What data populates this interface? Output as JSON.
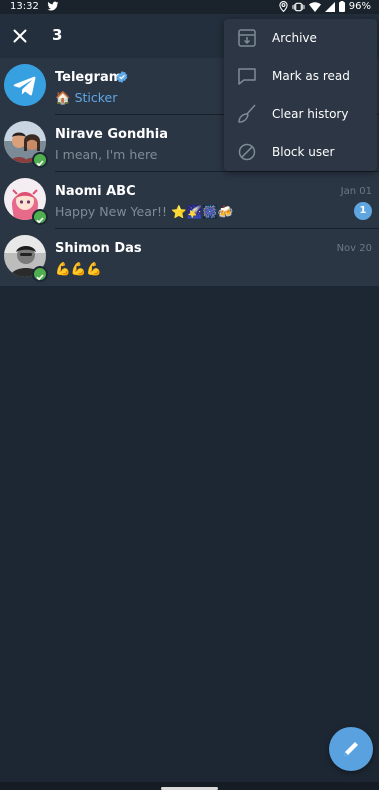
{
  "status_bar": {
    "time": "13:32",
    "battery": "96%",
    "icons": [
      "twitter-icon",
      "location-icon",
      "vibrate-icon",
      "wifi-icon",
      "signal-icon",
      "battery-icon"
    ]
  },
  "action_bar": {
    "selected_count": "3",
    "close_icon": "close-icon"
  },
  "chats": [
    {
      "name": "Telegram",
      "verified": true,
      "message_emoji": "🏠",
      "message": "Sticker",
      "date": "",
      "unread": "",
      "selected": true
    },
    {
      "name": "Nirave Gondhia",
      "message": "I mean, I'm here",
      "date": "",
      "unread": "",
      "selected": true
    },
    {
      "name": "Naomi ABC",
      "message": "Happy New Year!! ⭐🌠🎆🍻",
      "date": "Jan 01",
      "unread": "1",
      "selected": true
    },
    {
      "name": "Shimon Das",
      "message": "💪💪💪",
      "date": "Nov 20",
      "unread": "",
      "selected": true
    }
  ],
  "context_menu": {
    "items": [
      {
        "label": "Archive",
        "icon": "archive-icon"
      },
      {
        "label": "Mark as read",
        "icon": "chat-bubble-icon"
      },
      {
        "label": "Clear history",
        "icon": "broom-icon"
      },
      {
        "label": "Block user",
        "icon": "block-icon"
      }
    ]
  },
  "fab": {
    "icon": "pencil-icon"
  },
  "colors": {
    "background": "#1d2733",
    "action_bar": "#242f3d",
    "menu": "#2c3644",
    "accent": "#5aa2df",
    "selected_check": "#4fae4e"
  }
}
